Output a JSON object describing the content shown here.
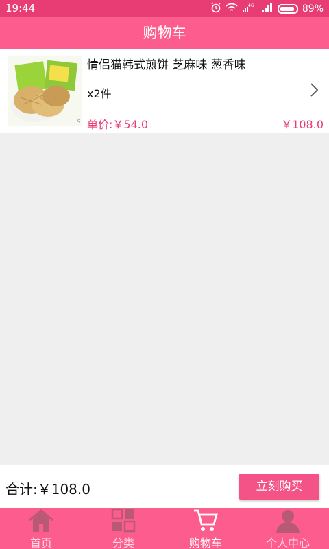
{
  "status_bar": {
    "time": "19:44",
    "battery": "89%",
    "network": "4G"
  },
  "header": {
    "title": "购物车"
  },
  "cart_item": {
    "name": "情侣猫韩式煎饼 芝麻味 葱香味",
    "quantity": "x2件",
    "unit_price": "单价:￥54.0",
    "line_total": "￥108.0"
  },
  "summary": {
    "total": "合计:￥108.0",
    "buy_button": "立刻购买"
  },
  "tabs": [
    {
      "label": "首页",
      "icon": "home-icon"
    },
    {
      "label": "分类",
      "icon": "grid-icon"
    },
    {
      "label": "购物车",
      "icon": "cart-icon"
    },
    {
      "label": "个人中心",
      "icon": "person-icon"
    }
  ],
  "colors": {
    "status_bar": "#e83d74",
    "accent": "#fd5c8e",
    "price": "#e83d74"
  }
}
